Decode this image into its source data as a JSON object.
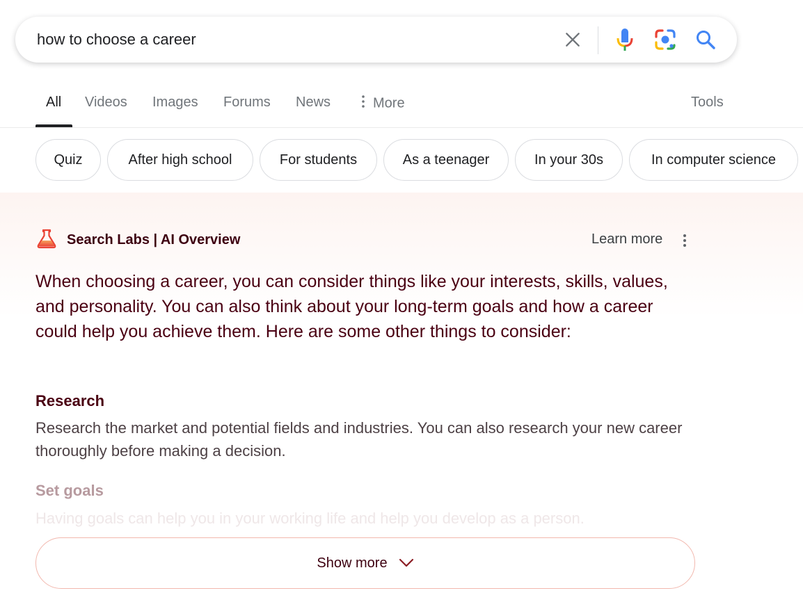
{
  "search": {
    "query": "how to choose a career"
  },
  "icons": {
    "clear": "close-icon",
    "voice": "microphone-icon",
    "lens": "camera-lens-icon",
    "search": "magnifier-icon"
  },
  "tabs": [
    {
      "label": "All",
      "active": true
    },
    {
      "label": "Videos",
      "active": false
    },
    {
      "label": "Images",
      "active": false
    },
    {
      "label": "Forums",
      "active": false
    },
    {
      "label": "News",
      "active": false
    },
    {
      "label": "More",
      "active": false
    }
  ],
  "tools_label": "Tools",
  "chips": [
    "Quiz",
    "After high school",
    "For students",
    "As a teenager",
    "In your 30s",
    "In computer science"
  ],
  "ai_overview": {
    "title": "Search Labs | AI Overview",
    "learn_more": "Learn more",
    "summary": "When choosing a career, you can consider things like your interests, skills, values, and personality. You can also think about your long-term goals and how a career could help you achieve them. Here are some other things to consider:",
    "sections": [
      {
        "heading": "Research",
        "body": "Research the market and potential fields and industries. You can also research your new career thoroughly before making a decision."
      },
      {
        "heading": "Set goals",
        "body": "Having goals can help you in your working life and help you develop as a person."
      }
    ],
    "show_more": "Show more"
  },
  "colors": {
    "google_blue": "#4285f4",
    "google_red": "#ea4335",
    "google_yellow": "#fbbc04",
    "google_green": "#34a853",
    "ai_text": "#4a0012",
    "ai_accent": "#f25c3e"
  }
}
